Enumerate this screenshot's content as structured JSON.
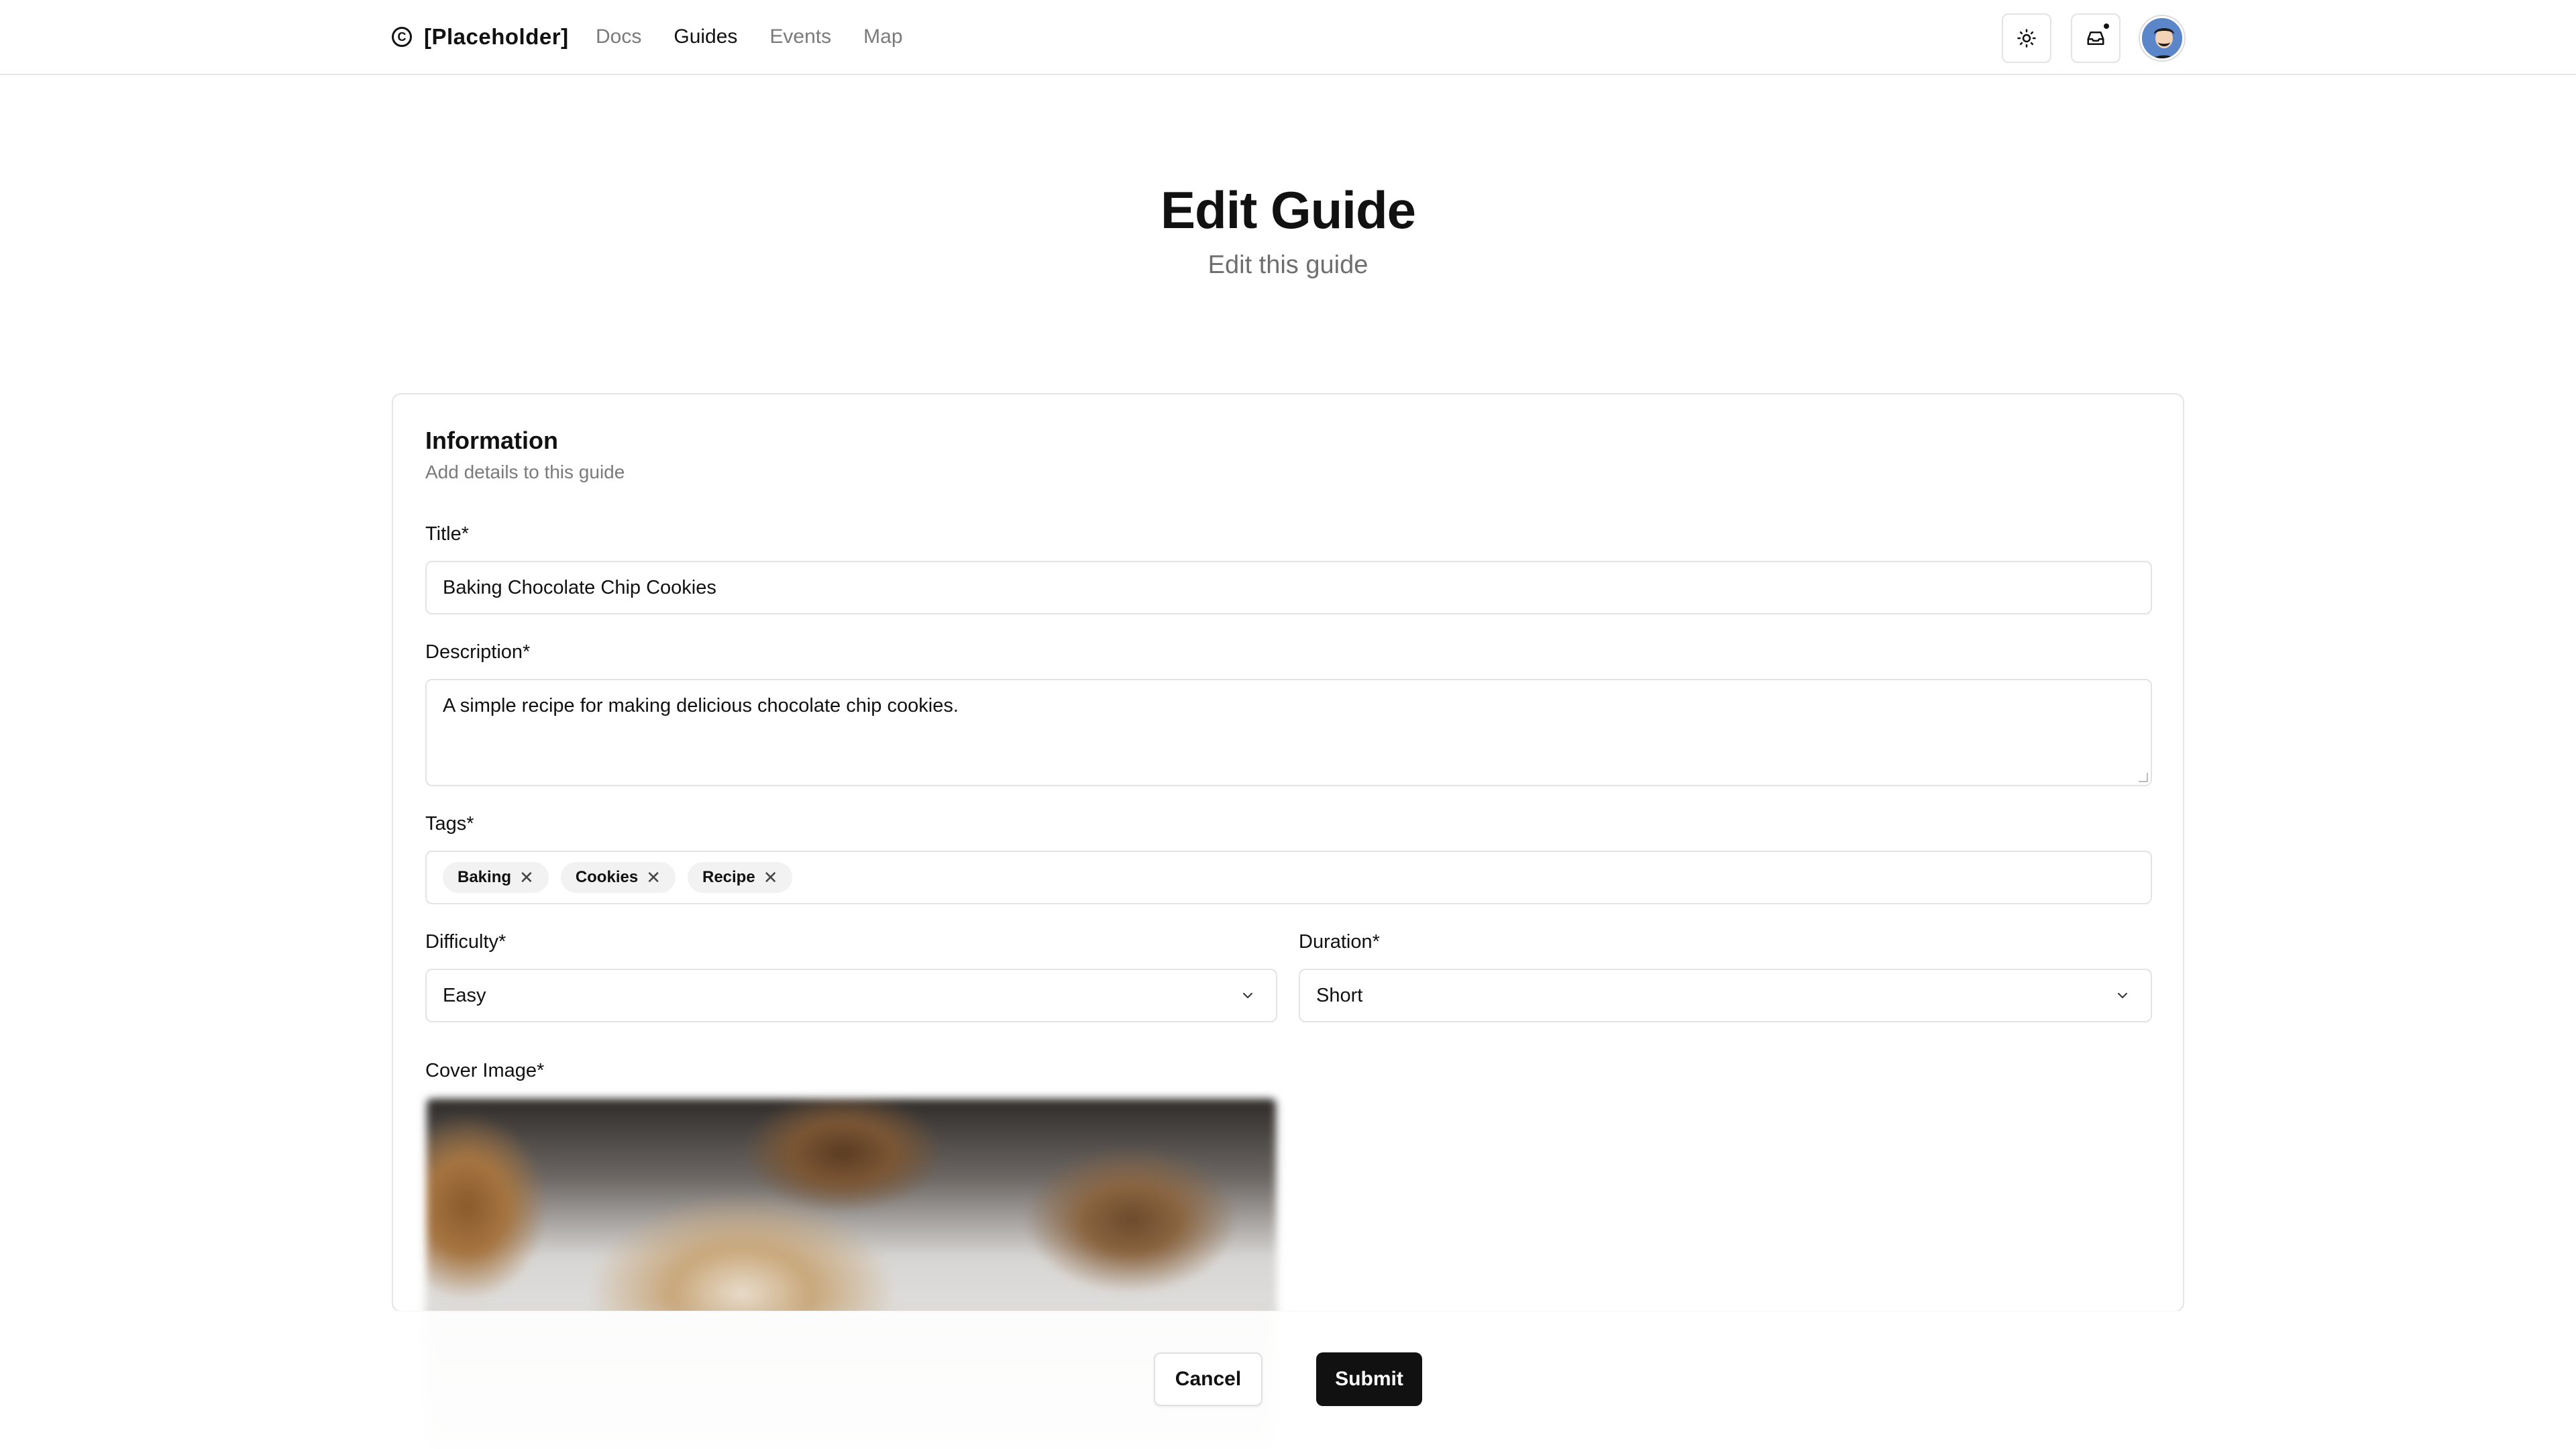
{
  "brand": {
    "icon": "copyright-icon",
    "name": "[Placeholder]"
  },
  "nav": [
    {
      "label": "Docs",
      "active": false
    },
    {
      "label": "Guides",
      "active": true
    },
    {
      "label": "Events",
      "active": false
    },
    {
      "label": "Map",
      "active": false
    }
  ],
  "header_actions": {
    "theme_icon": "sun-icon",
    "inbox_icon": "inbox-icon",
    "inbox_has_notification": true,
    "avatar": "user-avatar"
  },
  "hero": {
    "title": "Edit Guide",
    "subtitle": "Edit this guide"
  },
  "form": {
    "section_title": "Information",
    "section_subtitle": "Add details to this guide",
    "title_label": "Title*",
    "title_value": "Baking Chocolate Chip Cookies",
    "description_label": "Description*",
    "description_value": "A simple recipe for making delicious chocolate chip cookies.",
    "tags_label": "Tags*",
    "tags": [
      "Baking",
      "Cookies",
      "Recipe"
    ],
    "difficulty_label": "Difficulty*",
    "difficulty_value": "Easy",
    "duration_label": "Duration*",
    "duration_value": "Short",
    "cover_label": "Cover Image*"
  },
  "actions": {
    "cancel": "Cancel",
    "submit": "Submit"
  },
  "colors": {
    "primary": "#111111",
    "muted_text": "#7a7a7a",
    "border": "#e3e3e3"
  }
}
